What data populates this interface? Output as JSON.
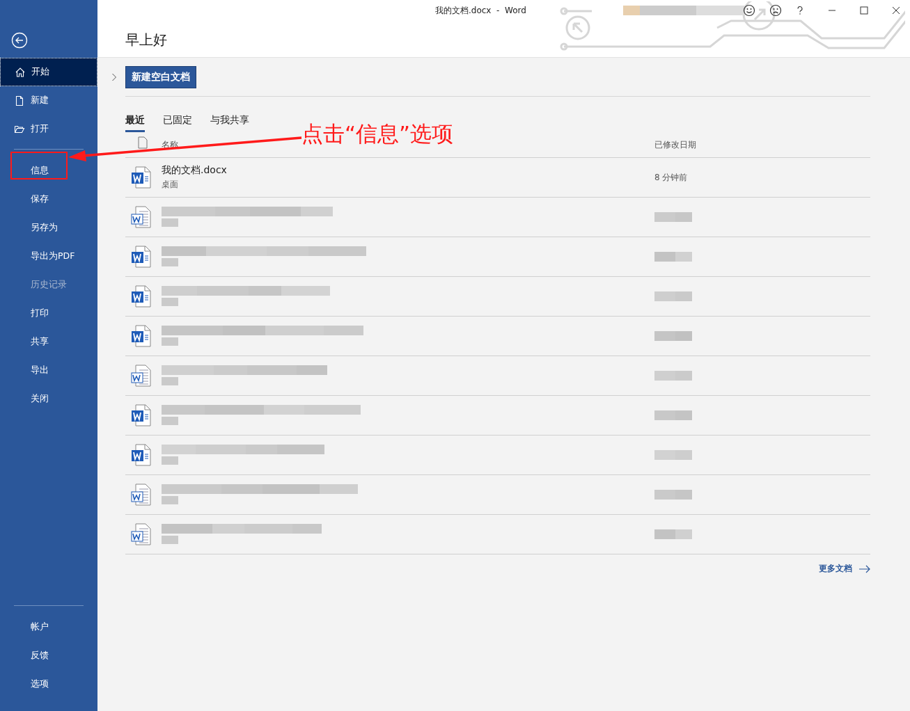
{
  "window": {
    "title": "我的文档.docx  -  Word"
  },
  "header": {
    "greeting": "早上好"
  },
  "sidebar": {
    "top_items": [
      {
        "label": "开始",
        "selected": true
      },
      {
        "label": "新建",
        "selected": false
      },
      {
        "label": "打开",
        "selected": false
      }
    ],
    "items": [
      {
        "label": "信息",
        "selected": false,
        "disabled": false
      },
      {
        "label": "保存",
        "selected": false,
        "disabled": false
      },
      {
        "label": "另存为",
        "selected": false,
        "disabled": false
      },
      {
        "label": "导出为PDF",
        "selected": false,
        "disabled": false
      },
      {
        "label": "历史记录",
        "selected": false,
        "disabled": true
      },
      {
        "label": "打印",
        "selected": false,
        "disabled": false
      },
      {
        "label": "共享",
        "selected": false,
        "disabled": false
      },
      {
        "label": "导出",
        "selected": false,
        "disabled": false
      },
      {
        "label": "关闭",
        "selected": false,
        "disabled": false
      }
    ],
    "bottom_items": [
      {
        "label": "帐户",
        "selected": false
      },
      {
        "label": "反馈",
        "selected": false
      },
      {
        "label": "选项",
        "selected": false
      }
    ]
  },
  "new_button": "新建空白文档",
  "tabs": [
    {
      "label": "最近",
      "selected": true
    },
    {
      "label": "已固定",
      "selected": false
    },
    {
      "label": "与我共享",
      "selected": false
    }
  ],
  "table": {
    "columns": [
      "名称",
      "已修改日期"
    ],
    "rows": [
      {
        "kind": "docx",
        "redacted": false,
        "name": "我的文档.docx",
        "location": "桌面",
        "modified": "8 分钟前"
      },
      {
        "kind": "doc",
        "redacted": true
      },
      {
        "kind": "docx",
        "redacted": true
      },
      {
        "kind": "docx",
        "redacted": true
      },
      {
        "kind": "docx",
        "redacted": true
      },
      {
        "kind": "doc",
        "redacted": true
      },
      {
        "kind": "docx",
        "redacted": true
      },
      {
        "kind": "docx",
        "redacted": true
      },
      {
        "kind": "doc",
        "redacted": true
      },
      {
        "kind": "doc",
        "redacted": true
      }
    ]
  },
  "more_link": "更多文档",
  "annotation": {
    "text": "点击“信息”选项"
  }
}
